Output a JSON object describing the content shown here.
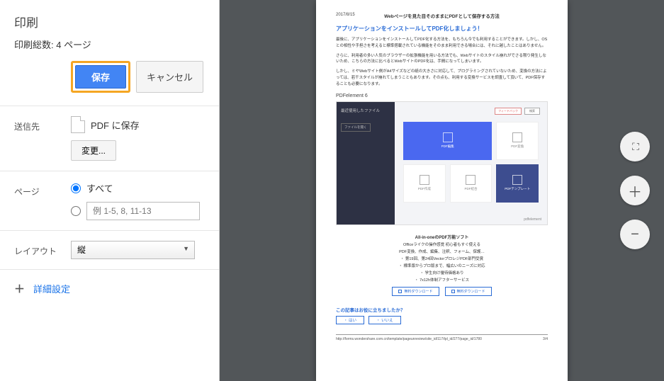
{
  "panel": {
    "title": "印刷",
    "subtitle": "印刷総数: 4 ページ",
    "save_label": "保存",
    "cancel_label": "キャンセル"
  },
  "destination": {
    "label": "送信先",
    "value": "PDF に保存",
    "change_label": "変更..."
  },
  "pages": {
    "label": "ページ",
    "all_label": "すべて",
    "range_placeholder": "例 1-5, 8, 11-13"
  },
  "layout": {
    "label": "レイアウト",
    "value": "縦"
  },
  "advanced": {
    "label": "詳細設定"
  },
  "preview": {
    "date": "2017/8/15",
    "head_title": "Webページを見た目そのままにPDFとして保存する方法",
    "h2": "アプリケーションをインストールしてPDF化しましょう！",
    "p1": "最後に、アプリケーションをインストールしてPDF化する方法を、もちろん今でも利用することができます。しかし、OSとの相性や手担さを考えると標準搭載されている機能をそのまま利用できる場合には、それに越したことはありません。",
    "p2": "さらに、利用者の多い人気のブラウザーの拡張機能を用いる方法でも、Webサイトのスタイル崩れがでさる限り発生しないため、こちらの方法に比べるとWebサイトのPDF化は、手間になってしまいます。",
    "p3": "しかし、ミヤWebサイト側がA4サイズなどの紙の大きさに対応して、プログラミングされていないため、変換の方法によっては、若干スタイルが崩れてしまうこともあります。その点も、利用する変換サービスを調査して頂いて、PDF保存することも必要になります。",
    "h3": "PDFelement 6",
    "app": {
      "sidebar_title": "最近使用したファイル",
      "sidebar_btn": "ファイルを開く",
      "tag1": "フィードバック",
      "tag2": "検索",
      "tiles": [
        "PDF編集",
        "PDF変換",
        "PDF作成",
        "PDF結合",
        "PDFテンプレート"
      ],
      "brand": "pdfelement"
    },
    "promo": {
      "title": "All-in-oneのPDF万能ソフト",
      "line1": "Officeライクの操作感覚 初心者もすぐ使える",
      "line2": "PDF変換、作成、編集、注釈、フォーム、保護…",
      "bullet1": "第19回、第24回VectorプロレジPDF部門受賞",
      "bullet2": "標準版からプロ版まで、幅広いのニーズに対応",
      "bullet3": "学生向け優待価格あり",
      "bullet4": "7x12h体制アフターサービス",
      "btn": "無料ダウンロード"
    },
    "feedback": {
      "question": "この記事はお役に立ちましたか？",
      "yes": "はい",
      "no": "いいえ"
    },
    "footer_url": "http://forms.wondershare.com.cn/template/pageunreview/site_id/117/tpl_id/277/page_id/1780",
    "footer_page": "3/4"
  }
}
